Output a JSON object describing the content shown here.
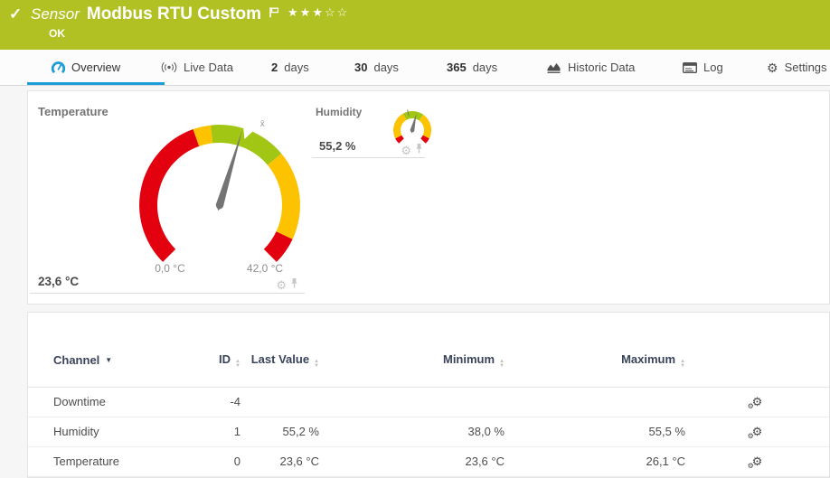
{
  "header": {
    "type_label": "Sensor",
    "title": "Modbus RTU Custom",
    "status": "OK",
    "rating_filled": 3,
    "rating_total": 5
  },
  "tabs": [
    {
      "id": "overview",
      "icon": "gauge-icon",
      "label": "Overview",
      "active": true
    },
    {
      "id": "live-data",
      "icon": "live-icon",
      "label": "Live Data"
    },
    {
      "id": "2-days",
      "bold": "2",
      "label": "days"
    },
    {
      "id": "30-days",
      "bold": "30",
      "label": "days"
    },
    {
      "id": "365-days",
      "bold": "365",
      "label": "days"
    },
    {
      "id": "historic-data",
      "icon": "historic-icon",
      "label": "Historic Data"
    },
    {
      "id": "log",
      "icon": "log-icon",
      "label": "Log"
    },
    {
      "id": "settings",
      "icon": "settings-icon",
      "label": "Settings"
    }
  ],
  "gauges": [
    {
      "name": "Temperature",
      "value": 23.6,
      "value_label": "23,6 °C",
      "min": 0,
      "max": 42,
      "min_label": "0,0 °C",
      "max_label": "42,0 °C",
      "avg": 24.2,
      "segments": [
        {
          "from": 0,
          "to": 18,
          "color": "#e3000f"
        },
        {
          "from": 18,
          "to": 20,
          "color": "#fdc300"
        },
        {
          "from": 20,
          "to": 28.8,
          "color": "#a2c614"
        },
        {
          "from": 28.8,
          "to": 38.9,
          "color": "#fdc300"
        },
        {
          "from": 38.9,
          "to": 42,
          "color": "#e3000f"
        }
      ]
    },
    {
      "name": "Humidity",
      "value": 55.2,
      "value_label": "55,2 %",
      "min": 0,
      "max": 100,
      "min_label": "",
      "max_label": "",
      "avg": 45,
      "segments": [
        {
          "from": 0,
          "to": 7,
          "color": "#e3000f"
        },
        {
          "from": 7,
          "to": 39,
          "color": "#fdc300"
        },
        {
          "from": 39,
          "to": 63,
          "color": "#a2c614"
        },
        {
          "from": 63,
          "to": 93,
          "color": "#fdc300"
        },
        {
          "from": 93,
          "to": 100,
          "color": "#e3000f"
        }
      ]
    }
  ],
  "table": {
    "headers": [
      {
        "label": "Channel",
        "sort": "active-desc"
      },
      {
        "label": "ID",
        "sort": "both"
      },
      {
        "label": "Last Value",
        "sort": "both"
      },
      {
        "label": "Minimum",
        "sort": "both"
      },
      {
        "label": "Maximum",
        "sort": "both"
      }
    ],
    "rows": [
      {
        "channel": "Downtime",
        "id": "-4",
        "last_value": "",
        "minimum": "",
        "maximum": ""
      },
      {
        "channel": "Humidity",
        "id": "1",
        "last_value": "55,2 %",
        "minimum": "38,0 %",
        "maximum": "55,5 %"
      },
      {
        "channel": "Temperature",
        "id": "0",
        "last_value": "23,6 °C",
        "minimum": "23,6 °C",
        "maximum": "26,1 °C"
      }
    ]
  },
  "colors": {
    "status_green": "#b1c124",
    "accent_blue": "#1c9dd8",
    "gauge_red": "#e3000f",
    "gauge_yellow": "#fdc300",
    "gauge_green": "#a2c614"
  }
}
